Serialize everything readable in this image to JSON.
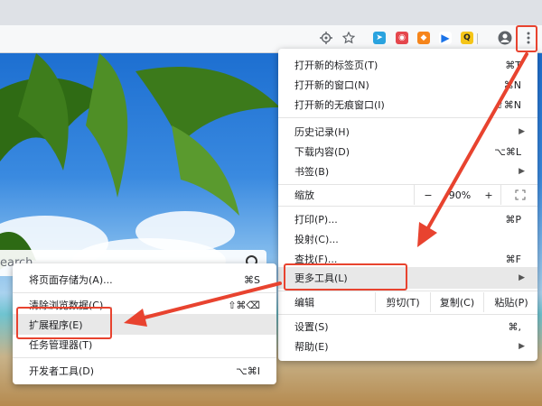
{
  "search": {
    "placeholder": "earch"
  },
  "toolbar": {
    "icons": [
      "crosshair-icon",
      "star-icon",
      "telegram-icon",
      "pocket-icon",
      "metamask-icon",
      "extension-icon",
      "play-icon",
      "q-icon",
      "profile-icon",
      "more-icon"
    ]
  },
  "main_menu": {
    "items": [
      {
        "label": "打开新的标签页(T)",
        "shortcut": "⌘T"
      },
      {
        "label": "打开新的窗口(N)",
        "shortcut": "⌘N"
      },
      {
        "label": "打开新的无痕窗口(I)",
        "shortcut": "⇧⌘N"
      },
      {
        "label": "历史记录(H)",
        "shortcut": ""
      },
      {
        "label": "下载内容(D)",
        "shortcut": "⌥⌘L"
      },
      {
        "label": "书签(B)",
        "shortcut": ""
      },
      {
        "label": "打印(P)...",
        "shortcut": "⌘P"
      },
      {
        "label": "投射(C)...",
        "shortcut": ""
      },
      {
        "label": "查找(F)...",
        "shortcut": "⌘F"
      },
      {
        "label": "更多工具(L)",
        "shortcut": ""
      },
      {
        "label": "设置(S)",
        "shortcut": "⌘,"
      },
      {
        "label": "帮助(E)",
        "shortcut": ""
      }
    ],
    "zoom": {
      "label": "缩放",
      "minus": "−",
      "value": "90%",
      "plus": "+"
    },
    "edit": {
      "label": "编辑",
      "cut": "剪切(T)",
      "copy": "复制(C)",
      "paste": "粘贴(P)"
    }
  },
  "submenu": {
    "items": [
      {
        "label": "将页面存储为(A)...",
        "shortcut": "⌘S"
      },
      {
        "label": "清除浏览数据(C)...",
        "shortcut": "⇧⌘⌫"
      },
      {
        "label": "扩展程序(E)",
        "shortcut": ""
      },
      {
        "label": "任务管理器(T)",
        "shortcut": ""
      },
      {
        "label": "开发者工具(D)",
        "shortcut": "⌥⌘I"
      }
    ]
  },
  "colors": {
    "annotation": "#e8432f",
    "highlight": "#e8e8e8"
  }
}
